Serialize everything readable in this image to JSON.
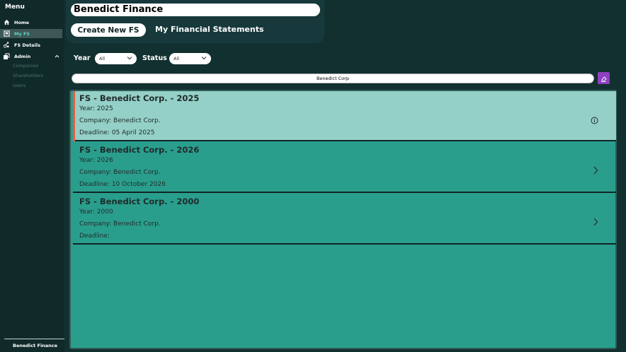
{
  "sidebar": {
    "menu_title": "Menu",
    "items": [
      {
        "label": "Home",
        "icon": "home-icon"
      },
      {
        "label": "My FS",
        "icon": "document-icon",
        "active": true
      },
      {
        "label": "FS Details",
        "icon": "details-icon"
      },
      {
        "label": "Admin",
        "icon": "admin-icon",
        "expanded": true
      }
    ],
    "admin_subitems": [
      "Companies",
      "Shareholders",
      "Users"
    ],
    "footer": "Benedict Finance"
  },
  "header": {
    "app_title": "Benedict Finance",
    "create_button": "Create New FS",
    "section_title": "My Financial Statements"
  },
  "filters": {
    "year_label": "Year",
    "year_value": "All",
    "status_label": "Status",
    "status_value": "All"
  },
  "search": {
    "value": "Benedict Corp"
  },
  "statements": [
    {
      "title": "FS - Benedict Corp. - 2025",
      "year": "Year: 2025",
      "company": "Company: Benedict Corp.",
      "deadline": "Deadline: 05 April 2025",
      "selected": true,
      "icon": "info-icon"
    },
    {
      "title": "FS - Benedict Corp. - 2026",
      "year": "Year: 2026",
      "company": "Company: Benedict Corp.",
      "deadline": "Deadline: 10 October 2026",
      "selected": false,
      "icon": "chevron-right-icon"
    },
    {
      "title": "FS - Benedict Corp. - 2000",
      "year": "Year: 2000",
      "company": "Company: Benedict Corp.",
      "deadline": "Deadline:",
      "selected": false,
      "icon": "chevron-right-icon"
    }
  ],
  "colors": {
    "background": "#12302f",
    "accent_teal": "#2a9e8d",
    "selected_row": "#94d0c7",
    "selection_marker": "#ed5a3f",
    "clear_button": "#8e3fc2"
  }
}
